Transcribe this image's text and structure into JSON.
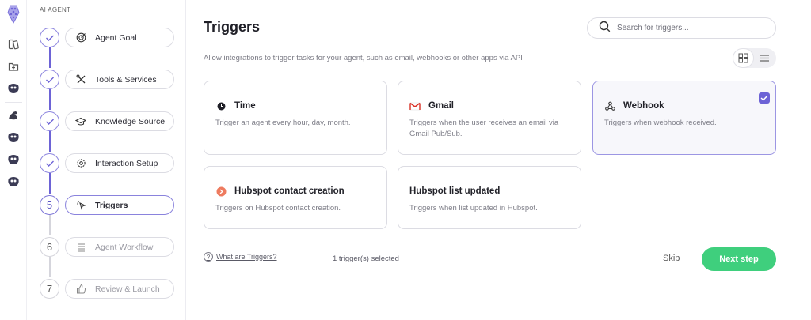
{
  "sidebar": {
    "section_label": "AI AGENT"
  },
  "steps": [
    {
      "number": "1",
      "label": "Agent Goal",
      "status": "done",
      "icon": "target-icon"
    },
    {
      "number": "2",
      "label": "Tools & Services",
      "status": "done",
      "icon": "tools-icon"
    },
    {
      "number": "3",
      "label": "Knowledge Source",
      "status": "done",
      "icon": "graduation-cap-icon"
    },
    {
      "number": "4",
      "label": "Interaction Setup",
      "status": "done",
      "icon": "gear-icon"
    },
    {
      "number": "5",
      "label": "Triggers",
      "status": "active",
      "icon": "pointer-click-icon"
    },
    {
      "number": "6",
      "label": "Agent Workflow",
      "status": "todo",
      "icon": "list-icon"
    },
    {
      "number": "7",
      "label": "Review & Launch",
      "status": "todo",
      "icon": "thumbs-up-icon"
    }
  ],
  "main": {
    "title": "Triggers",
    "subtitle": "Allow integrations to trigger tasks for your agent, such as email, webhooks or other apps via API",
    "search_placeholder": "Search for triggers...",
    "help_link": "What are Triggers?",
    "selected_count": "1 trigger(s) selected",
    "skip_label": "Skip",
    "next_label": "Next step"
  },
  "triggers": [
    {
      "title": "Time",
      "description": "Trigger an agent every hour, day, month.",
      "icon": "clock-icon",
      "selected": false
    },
    {
      "title": "Gmail",
      "description": "Triggers when the user receives an email via Gmail Pub/Sub.",
      "icon": "gmail-icon",
      "selected": false
    },
    {
      "title": "Webhook",
      "description": "Triggers when webhook received.",
      "icon": "webhook-icon",
      "selected": true
    },
    {
      "title": "Hubspot contact creation",
      "description": "Triggers on Hubspot contact creation.",
      "icon": "hubspot-icon",
      "selected": false
    },
    {
      "title": "Hubspot list updated",
      "description": "Triggers when list updated in Hubspot.",
      "icon": "",
      "selected": false
    }
  ],
  "colors": {
    "accent": "#6d63d6",
    "primary_button": "#3fcf7d",
    "selected_border": "#9c96e3"
  }
}
